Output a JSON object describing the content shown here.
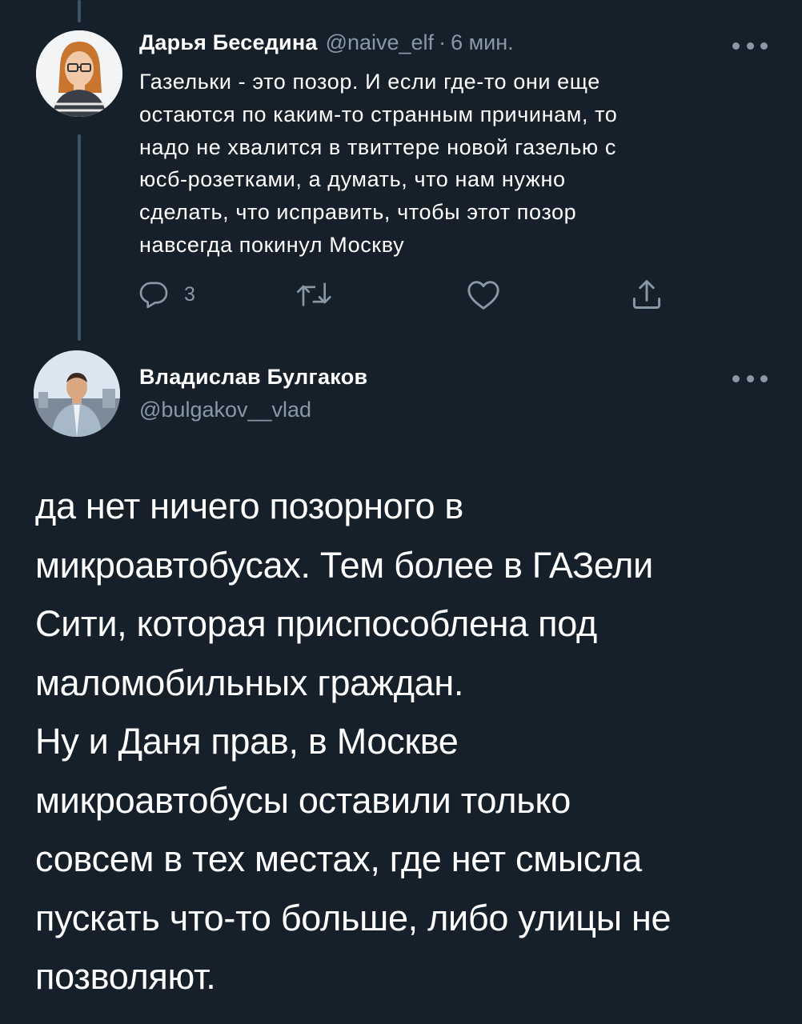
{
  "tweet1": {
    "display_name": "Дарья Беседина",
    "handle": "@naive_elf",
    "separator": "·",
    "time": "6 мин.",
    "text": "Газельки - это позор. И если где-то они еще\nостаются по каким-то странным причинам, то\nнадо не хвалится в твиттере новой газелью с\nюсб-розетками, а думать, что нам нужно\nсделать, что исправить, чтобы этот позор\nнавсегда покинул Москву",
    "actions": {
      "reply_icon": "reply-icon",
      "reply_count": "3",
      "retweet_icon": "retweet-icon",
      "like_icon": "heart-icon",
      "share_icon": "share-icon"
    }
  },
  "tweet2": {
    "display_name": "Владислав Булгаков",
    "handle": "@bulgakov__vlad",
    "text": "да нет ничего позорного в\nмикроавтобусах. Тем более в ГАЗели\nСити, которая приспособлена под\nмаломобильных граждан.\nНу и Даня прав, в Москве\nмикроавтобусы оставили только\nсовсем в тех местах, где нет смысла\nпускать что-то больше, либо улицы не\nпозволяют."
  },
  "colors": {
    "background": "#15202b",
    "text_primary": "#ffffff",
    "text_secondary": "#8899a6",
    "thread_line": "#3d5466"
  }
}
